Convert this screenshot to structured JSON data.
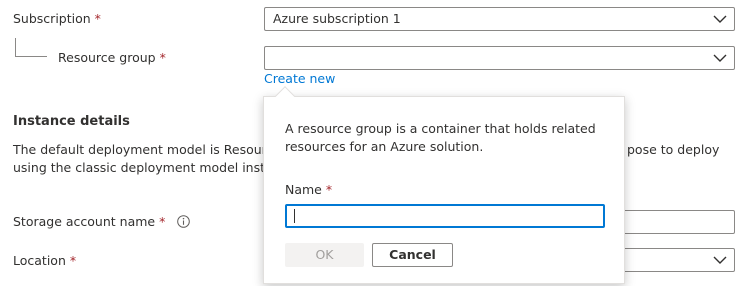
{
  "subscription": {
    "label": "Subscription",
    "required_mark": "*",
    "value": "Azure subscription 1"
  },
  "resource_group": {
    "label": "Resource group",
    "required_mark": "*",
    "value": "",
    "create_new_link": "Create new"
  },
  "instance_details": {
    "title": "Instance details",
    "description_line1_left": "The default deployment model is Resource",
    "description_line1_right": "pose to deploy",
    "description_line2_left": "using the classic deployment model instead"
  },
  "storage_account_name": {
    "label": "Storage account name",
    "required_mark": "*",
    "value": ""
  },
  "location": {
    "label": "Location",
    "required_mark": "*",
    "value": ""
  },
  "callout": {
    "description_line1": "A resource group is a container that holds related",
    "description_line2": "resources for an Azure solution.",
    "name_label": "Name",
    "name_required_mark": "*",
    "name_value": "",
    "ok_label": "OK",
    "cancel_label": "Cancel"
  },
  "icons": {
    "chevron": "chevron-down-icon",
    "info": "info-icon"
  },
  "colors": {
    "link": "#0078d4",
    "required": "#a4262c",
    "focus_border": "#0078d4"
  }
}
